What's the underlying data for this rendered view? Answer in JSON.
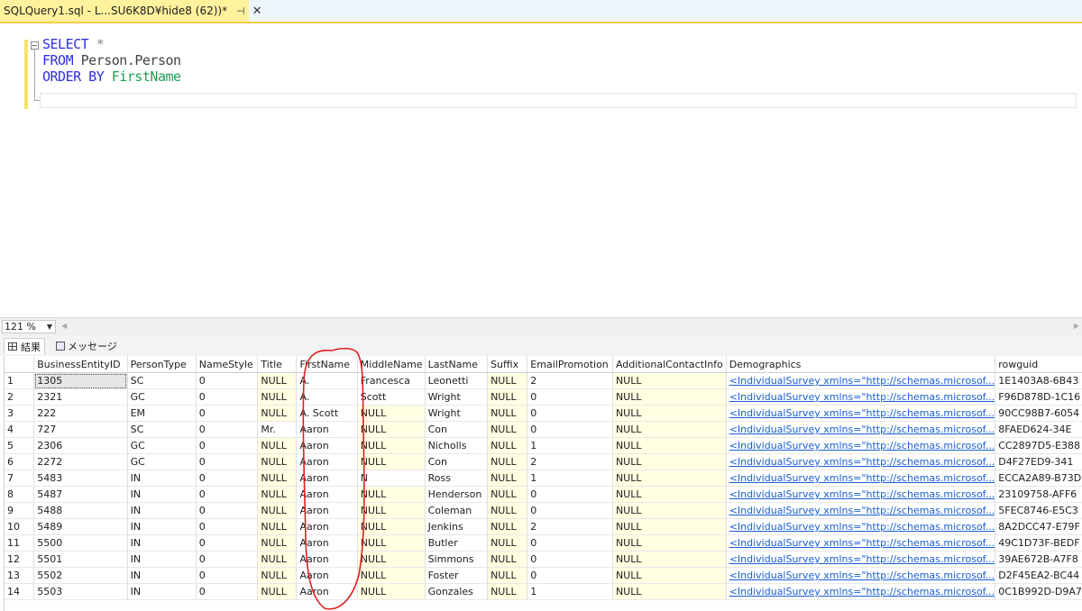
{
  "tab": {
    "title": "SQLQuery1.sql - L...SU6K8D¥hide8 (62))*",
    "pin": "⊣",
    "close": "✕"
  },
  "code": {
    "line1_kw": "SELECT",
    "line1_rest": " *",
    "line2_kw": "FROM",
    "line2_rest": " Person.Person",
    "line3_kw": "ORDER BY",
    "line3_rest": " FirstName"
  },
  "zoom": {
    "value": "121 %"
  },
  "results_tabs": {
    "results": "結果",
    "messages": "メッセージ"
  },
  "grid": {
    "columns": [
      "",
      "BusinessEntityID",
      "PersonType",
      "NameStyle",
      "Title",
      "FirstName",
      "MiddleName",
      "LastName",
      "Suffix",
      "EmailPromotion",
      "AdditionalContactInfo",
      "Demographics",
      "rowguid"
    ],
    "rows": [
      [
        "1",
        "1305",
        "SC",
        "0",
        "NULL",
        "A.",
        "Francesca",
        "Leonetti",
        "NULL",
        "2",
        "NULL",
        "<IndividualSurvey xmlns=\"http://schemas.microsof...",
        "1E1403A8-6B43"
      ],
      [
        "2",
        "2321",
        "GC",
        "0",
        "NULL",
        "A.",
        "Scott",
        "Wright",
        "NULL",
        "0",
        "NULL",
        "<IndividualSurvey xmlns=\"http://schemas.microsof...",
        "F96D878D-1C16"
      ],
      [
        "3",
        "222",
        "EM",
        "0",
        "NULL",
        "A. Scott",
        "NULL",
        "Wright",
        "NULL",
        "0",
        "NULL",
        "<IndividualSurvey xmlns=\"http://schemas.microsof...",
        "90CC98B7-6054"
      ],
      [
        "4",
        "727",
        "SC",
        "0",
        "Mr.",
        "Aaron",
        "NULL",
        "Con",
        "NULL",
        "0",
        "NULL",
        "<IndividualSurvey xmlns=\"http://schemas.microsof...",
        "8FAED624-34E"
      ],
      [
        "5",
        "2306",
        "GC",
        "0",
        "NULL",
        "Aaron",
        "NULL",
        "Nicholls",
        "NULL",
        "1",
        "NULL",
        "<IndividualSurvey xmlns=\"http://schemas.microsof...",
        "CC2897D5-E388"
      ],
      [
        "6",
        "2272",
        "GC",
        "0",
        "NULL",
        "Aaron",
        "NULL",
        "Con",
        "NULL",
        "2",
        "NULL",
        "<IndividualSurvey xmlns=\"http://schemas.microsof...",
        "D4F27ED9-341"
      ],
      [
        "7",
        "5483",
        "IN",
        "0",
        "NULL",
        "Aaron",
        "N",
        "Ross",
        "NULL",
        "1",
        "NULL",
        "<IndividualSurvey xmlns=\"http://schemas.microsof...",
        "ECCA2A89-B73D"
      ],
      [
        "8",
        "5487",
        "IN",
        "0",
        "NULL",
        "Aaron",
        "NULL",
        "Henderson",
        "NULL",
        "0",
        "NULL",
        "<IndividualSurvey xmlns=\"http://schemas.microsof...",
        "23109758-AFF6"
      ],
      [
        "9",
        "5488",
        "IN",
        "0",
        "NULL",
        "Aaron",
        "NULL",
        "Coleman",
        "NULL",
        "0",
        "NULL",
        "<IndividualSurvey xmlns=\"http://schemas.microsof...",
        "5FEC8746-E5C3"
      ],
      [
        "10",
        "5489",
        "IN",
        "0",
        "NULL",
        "Aaron",
        "NULL",
        "Jenkins",
        "NULL",
        "2",
        "NULL",
        "<IndividualSurvey xmlns=\"http://schemas.microsof...",
        "8A2DCC47-E79F"
      ],
      [
        "11",
        "5500",
        "IN",
        "0",
        "NULL",
        "Aaron",
        "NULL",
        "Butler",
        "NULL",
        "0",
        "NULL",
        "<IndividualSurvey xmlns=\"http://schemas.microsof...",
        "49C1D73F-BEDF"
      ],
      [
        "12",
        "5501",
        "IN",
        "0",
        "NULL",
        "Aaron",
        "NULL",
        "Simmons",
        "NULL",
        "0",
        "NULL",
        "<IndividualSurvey xmlns=\"http://schemas.microsof...",
        "39AE672B-A7F8"
      ],
      [
        "13",
        "5502",
        "IN",
        "0",
        "NULL",
        "Aaron",
        "NULL",
        "Foster",
        "NULL",
        "0",
        "NULL",
        "<IndividualSurvey xmlns=\"http://schemas.microsof...",
        "D2F45EA2-BC44"
      ],
      [
        "14",
        "5503",
        "IN",
        "0",
        "NULL",
        "Aaron",
        "NULL",
        "Gonzales",
        "NULL",
        "1",
        "NULL",
        "<IndividualSurvey xmlns=\"http://schemas.microsof...",
        "0C1B992D-D9A7"
      ]
    ]
  },
  "colors": {
    "keyword": "#2f2fe0",
    "identifier_green": "#1f9e54",
    "tab_active": "#fff29d",
    "null_cell": "#ffffe1",
    "link": "#1a5fd1",
    "annotation": "#e02020"
  }
}
